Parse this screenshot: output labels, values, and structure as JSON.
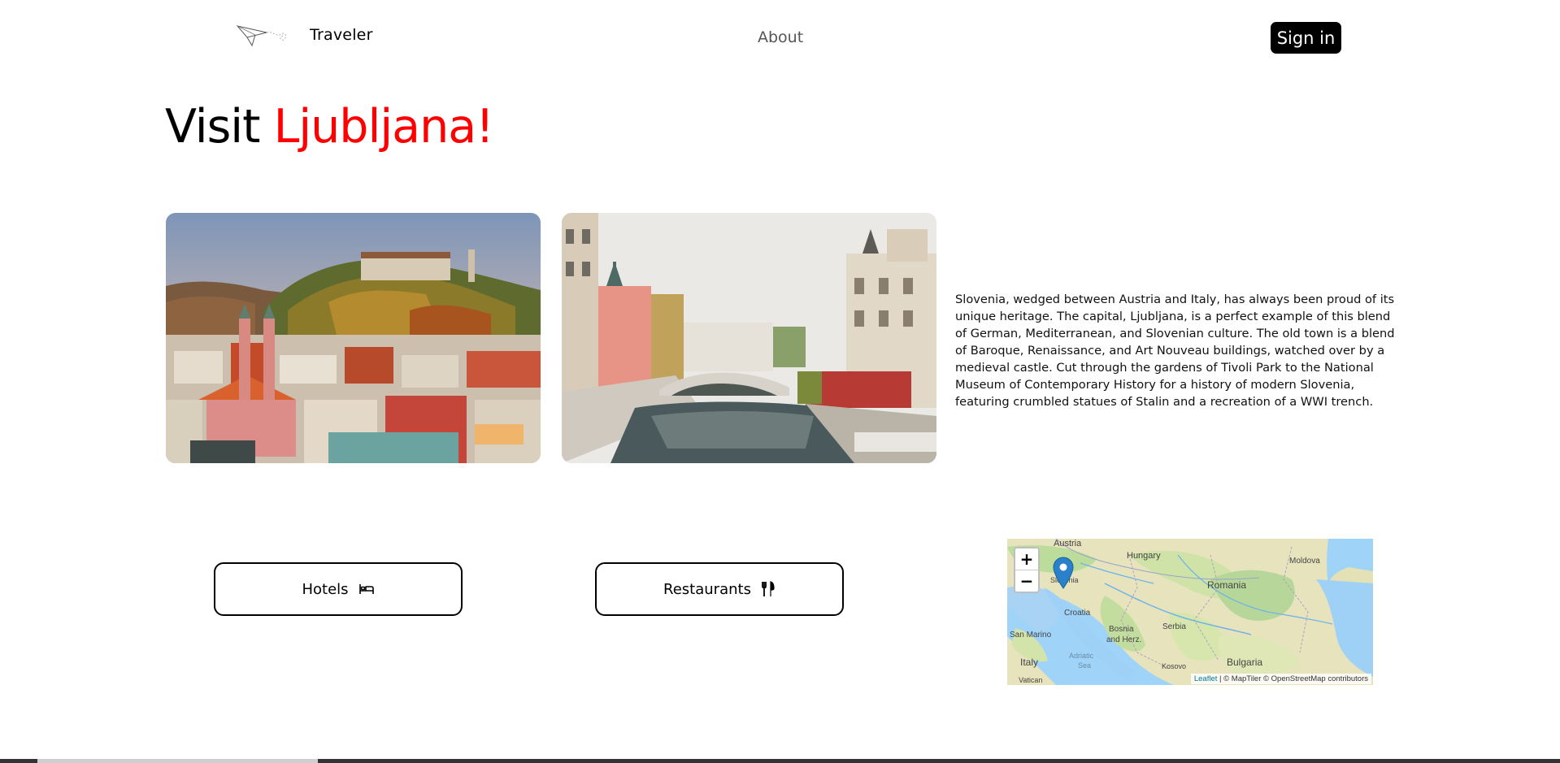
{
  "header": {
    "brand": "Traveler",
    "nav_about": "About",
    "signin_label": "Sign in",
    "logo_icon": "paper-plane-icon"
  },
  "hero": {
    "title_prefix": "Visit ",
    "title_city": "Ljubljana!",
    "accent_color": "#ff0000"
  },
  "photos": [
    {
      "subject": "Ljubljana old town with castle hill"
    },
    {
      "subject": "Ljubljanica river with Triple Bridge and Franciscan church"
    }
  ],
  "description": "Slovenia, wedged between Austria and Italy, has always been proud of its unique heritage. The capital, Ljubljana, is a perfect example of this blend of German, Mediterranean, and Slovenian culture. The old town is a blend of Baroque, Renaissance, and Art Nouveau buildings, watched over by a medieval castle. Cut through the gardens of Tivoli Park to the National Museum of Contemporary History for a history of modern Slovenia, featuring crumbled statues of Stalin and a recreation of a WWI trench.",
  "actions": {
    "hotels_label": "Hotels",
    "hotels_icon": "bed-icon",
    "restaurants_label": "Restaurants",
    "restaurants_icon": "fork-knife-icon"
  },
  "map": {
    "zoom_in": "+",
    "zoom_out": "−",
    "labels": {
      "austria": "Austria",
      "hungary": "Hungary",
      "moldova": "Moldova",
      "slovenia": "Slovenia",
      "romania": "Romania",
      "croatia": "Croatia",
      "san_marino": "San Marino",
      "bosnia_1": "Bosnia",
      "bosnia_2": "and Herz.",
      "serbia": "Serbia",
      "adriatic_1": "Adriatic",
      "adriatic_2": "Sea",
      "italy": "Italy",
      "kosovo": "Kosovo",
      "bulgaria": "Bulgaria",
      "vatican": "Vatican"
    },
    "attribution_leaflet": "Leaflet",
    "attribution_rest": " | © MapTiler © OpenStreetMap contributors",
    "marker_color": "#2a81cb",
    "marker_icon": "map-pin-icon"
  }
}
